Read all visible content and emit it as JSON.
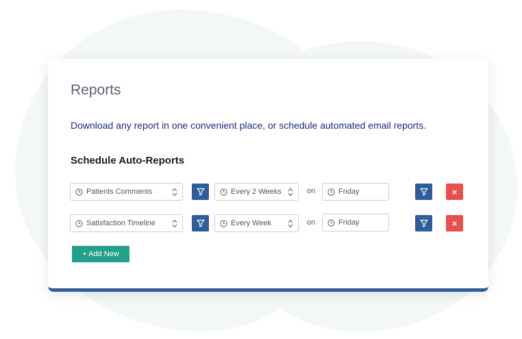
{
  "page": {
    "title": "Reports",
    "description": "Download any report in one convenient place, or schedule automated email reports.",
    "section_title": "Schedule Auto-Reports"
  },
  "schedules": [
    {
      "report": "Patients Comments",
      "frequency": "Every 2 Weeks",
      "on_label": "on",
      "day": "Friday"
    },
    {
      "report": "Satisfaction Timeline",
      "frequency": "Every Week",
      "on_label": "on",
      "day": "Friday"
    }
  ],
  "buttons": {
    "delete_label": "×",
    "add_new_label": "+ Add New"
  },
  "icons": {
    "field_icon": "clock-icon",
    "select_icon": "sort-arrows-icon",
    "filter_icon": "filter-icon",
    "delete_icon": "close-icon"
  },
  "colors": {
    "primary": "#2f5d98",
    "danger": "#e84f4f",
    "success": "#22a08c",
    "heading": "#5c6074",
    "description": "#1e2a7a"
  }
}
